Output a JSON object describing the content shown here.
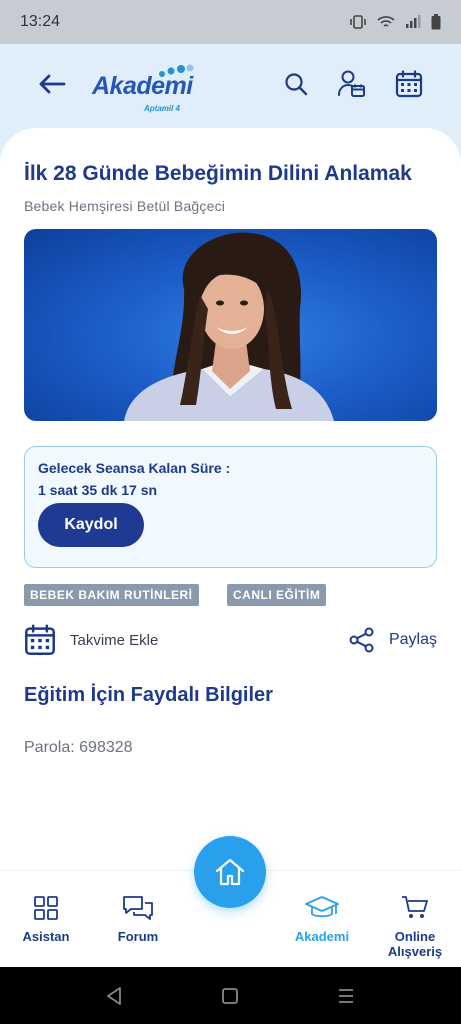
{
  "status_bar": {
    "time": "13:24"
  },
  "header": {
    "logo_main": "Akademi",
    "logo_sub": "Aptamil 4"
  },
  "content": {
    "title": "İlk 28 Günde Bebeğimin Dilini Anlamak",
    "subtitle": "Bebek Hemşiresi Betül Bağçeci",
    "session": {
      "label": "Gelecek Seansa Kalan Süre :",
      "remaining": "1 saat 35 dk 17 sn",
      "register_label": "Kaydol"
    },
    "tags": [
      "BEBEK BAKIM RUTİNLERİ",
      "CANLI EĞİTİM"
    ],
    "calendar_add_label": "Takvime Ekle",
    "share_label": "Paylaş",
    "section_title": "Eğitim İçin Faydalı Bilgiler",
    "password": "Parola: 698328"
  },
  "bottom_nav": {
    "items": [
      {
        "label": "Asistan",
        "icon": "grid-icon"
      },
      {
        "label": "Forum",
        "icon": "chat-icon"
      },
      {
        "label": "Akademi",
        "icon": "graduation-cap-icon",
        "active": true
      },
      {
        "label": "Online Alışveriş",
        "icon": "cart-icon"
      }
    ],
    "home_icon": "home-icon"
  },
  "colors": {
    "primary": "#1e3a8a",
    "accent": "#2aa0ec",
    "header_bg": "#dfeef9",
    "tag_bg": "#8a99ab"
  }
}
